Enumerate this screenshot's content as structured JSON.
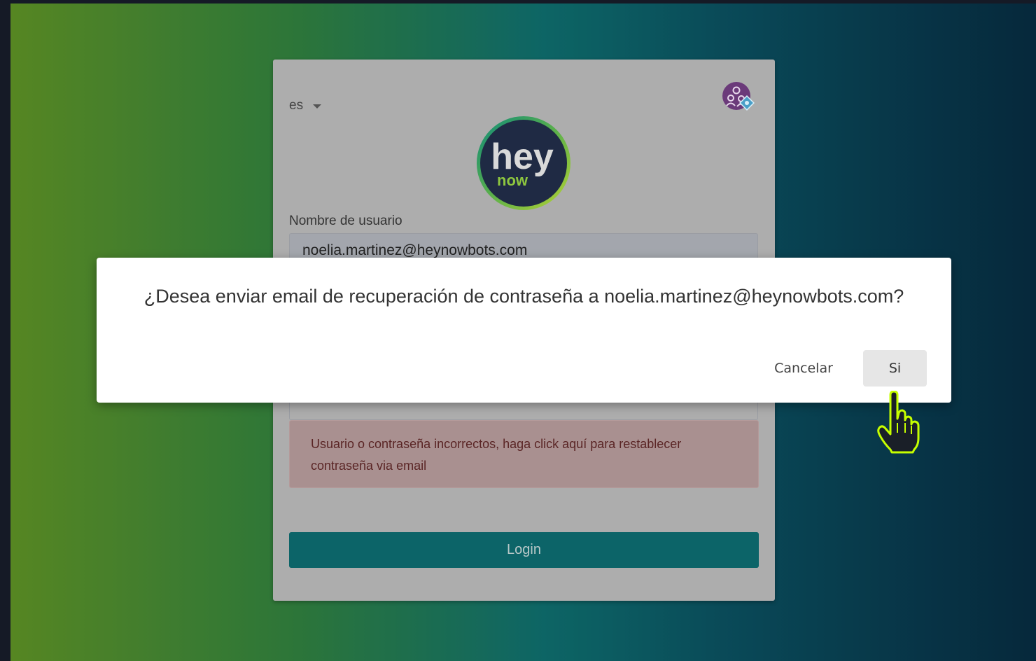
{
  "login_card": {
    "language": "es",
    "logo": {
      "line1": "hey",
      "line2": "now"
    },
    "username_label": "Nombre de usuario",
    "username_value": "noelia.martinez@heynowbots.com",
    "error_message": "Usuario o contraseña incorrectos, haga click aquí para restablecer contraseña via email",
    "login_button": "Login"
  },
  "dialog": {
    "message": "¿Desea enviar email de recuperación de contraseña a noelia.martinez@heynowbots.com?",
    "cancel_label": "Cancelar",
    "confirm_label": "Si"
  },
  "colors": {
    "primary": "#0c6468",
    "logo_navy": "#1f2a44",
    "logo_green": "#8dc63f",
    "cursor_accent": "#c6ff00"
  },
  "icons": {
    "language_dropdown": "chevron-down-icon",
    "admin": "users-settings-icon",
    "pointer": "hand-pointer-icon"
  }
}
